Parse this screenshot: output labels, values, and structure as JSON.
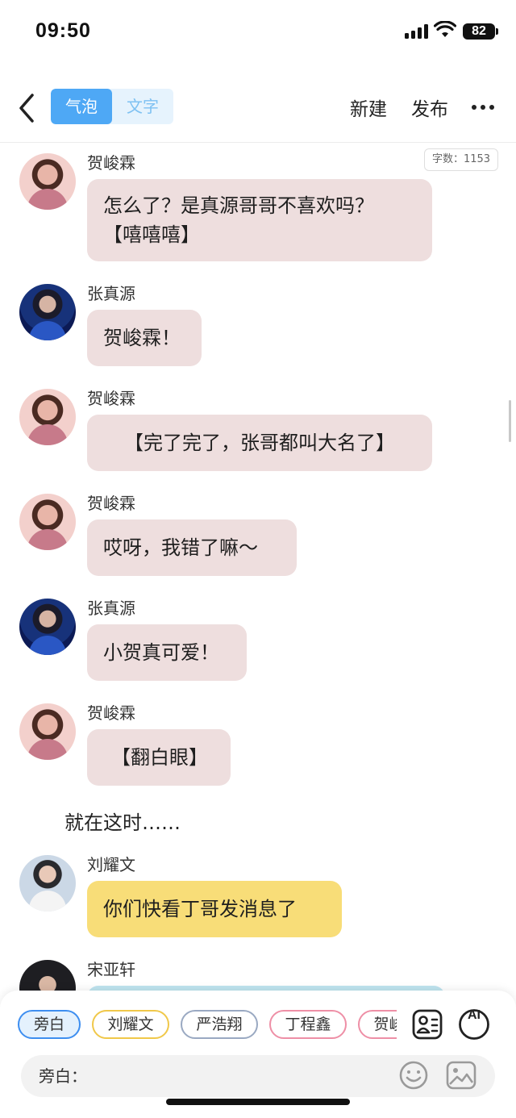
{
  "status_bar": {
    "time": "09:50",
    "battery": "82"
  },
  "header": {
    "mode_tabs": [
      "气泡",
      "文字"
    ],
    "active_tab": "气泡",
    "new_label": "新建",
    "publish_label": "发布"
  },
  "word_count": "字数：1153",
  "messages": [
    {
      "speaker": "贺峻霖",
      "text": [
        "怎么了？是真源哥哥不喜欢吗？",
        "【嘻嘻嘻】"
      ],
      "bubble_color": "#eedede"
    },
    {
      "speaker": "张真源",
      "text": [
        "贺峻霖！"
      ],
      "bubble_color": "#eedede"
    },
    {
      "speaker": "贺峻霖",
      "text": [
        "【完了完了，张哥都叫大名了】"
      ],
      "bubble_color": "#eedede"
    },
    {
      "speaker": "贺峻霖",
      "text": [
        "哎呀，我错了嘛～"
      ],
      "bubble_color": "#eedede"
    },
    {
      "speaker": "张真源",
      "text": [
        "小贺真可爱！"
      ],
      "bubble_color": "#eedede"
    },
    {
      "speaker": "贺峻霖",
      "text": [
        "【翻白眼】"
      ],
      "bubble_color": "#eedede"
    }
  ],
  "narration": "就在这时……",
  "messages_after": [
    {
      "speaker": "刘耀文",
      "text": [
        "你们快看丁哥发消息了"
      ],
      "bubble_color": "#f8dd78"
    },
    {
      "speaker": "宋亚轩",
      "text": [],
      "bubble_color": "#bfe4ef"
    }
  ],
  "role_chips": [
    "旁白",
    "刘耀文",
    "严浩翔",
    "丁程鑫",
    "贺峻霖"
  ],
  "active_role": "旁白",
  "tool_icons": [
    "role-card-icon",
    "ai-icon"
  ],
  "ai_label": "AI",
  "input": {
    "label": "旁白："
  },
  "colors": {
    "accent": "#4ea8f5",
    "pink_bubble": "#eedede",
    "yellow_bubble": "#f8dd78"
  }
}
